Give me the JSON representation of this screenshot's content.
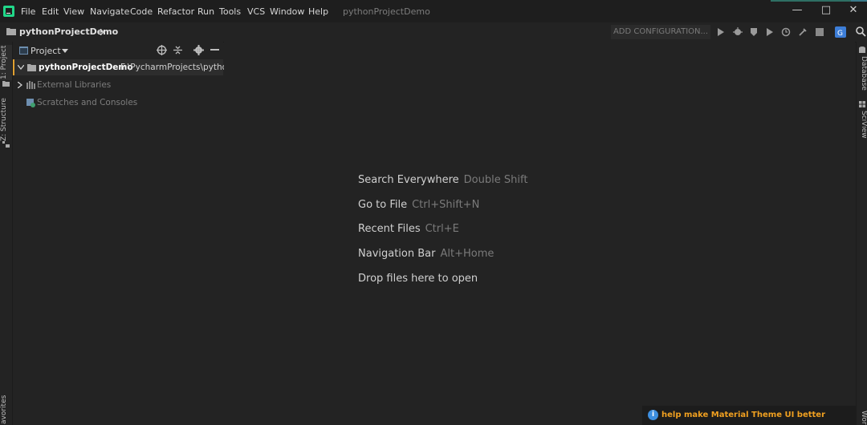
{
  "menu": {
    "items": [
      "File",
      "Edit",
      "View",
      "Navigate",
      "Code",
      "Refactor",
      "Run",
      "Tools",
      "VCS",
      "Window",
      "Help"
    ],
    "window_title": "pythonProjectDemo"
  },
  "navbar": {
    "breadcrumb": "pythonProjectDemo",
    "add_configuration": "ADD CONFIGURATION..."
  },
  "left_tabs": {
    "project": "1: Project",
    "structure": "Z: Structure",
    "favorites": "avorites"
  },
  "right_tabs": {
    "database": "Database",
    "sciview": "SciView",
    "bottom": "Wor"
  },
  "project_panel": {
    "title": "Project",
    "tree": [
      {
        "name": "pythonProjectDemo",
        "path": "F:\\PycharmProjects\\pythonP"
      },
      {
        "name": "External Libraries"
      },
      {
        "name": "Scratches and Consoles"
      }
    ]
  },
  "editor": {
    "tips": [
      {
        "label": "Search Everywhere",
        "shortcut": "Double Shift"
      },
      {
        "label": "Go to File",
        "shortcut": "Ctrl+Shift+N"
      },
      {
        "label": "Recent Files",
        "shortcut": "Ctrl+E"
      },
      {
        "label": "Navigation Bar",
        "shortcut": "Alt+Home"
      },
      {
        "label": "Drop files here to open",
        "shortcut": ""
      }
    ]
  },
  "notification": {
    "text": "help make Material Theme UI better"
  },
  "colors": {
    "accent_orange": "#f0a020",
    "selection_border": "#e0a030",
    "info_blue": "#3d8fe0"
  }
}
